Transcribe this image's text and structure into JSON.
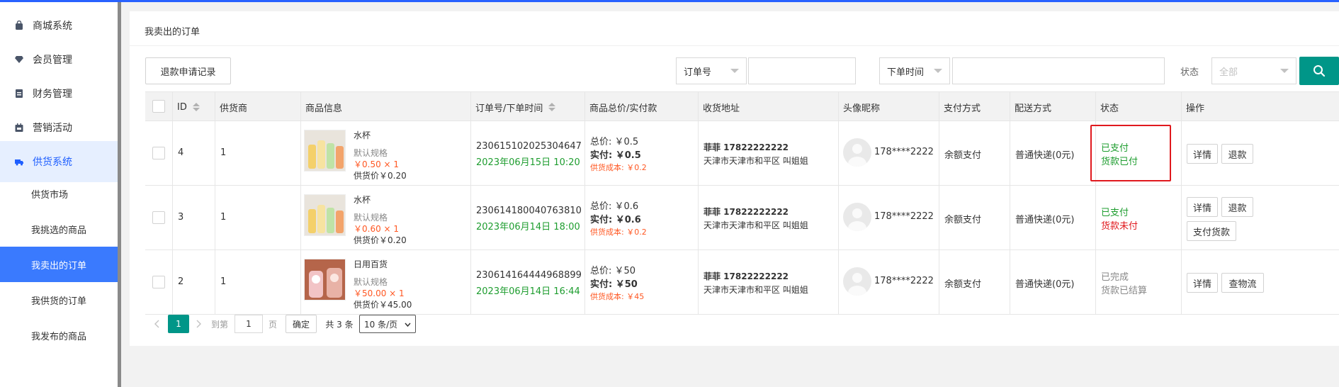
{
  "sidebar": {
    "items": [
      {
        "label": "商城系统",
        "icon": "bag-icon"
      },
      {
        "label": "会员管理",
        "icon": "diamond-icon"
      },
      {
        "label": "财务管理",
        "icon": "finance-icon"
      },
      {
        "label": "营销活动",
        "icon": "calendar-icon"
      },
      {
        "label": "供货系统",
        "icon": "truck-icon"
      }
    ],
    "subitems": [
      {
        "label": "供货市场"
      },
      {
        "label": "我挑选的商品"
      },
      {
        "label": "我卖出的订单"
      },
      {
        "label": "我供货的订单"
      },
      {
        "label": "我发布的商品"
      }
    ]
  },
  "page": {
    "title": "我卖出的订单",
    "refund_button": "退款申请记录",
    "filter1_label": "订单号",
    "filter2_label": "下单时间",
    "status_label": "状态",
    "status_placeholder": "全部"
  },
  "table": {
    "headers": [
      "ID",
      "供货商",
      "商品信息",
      "订单号/下单时间",
      "商品总价/实付款",
      "收货地址",
      "头像昵称",
      "支付方式",
      "配送方式",
      "状态",
      "操作"
    ],
    "rows": [
      {
        "id": "4",
        "supplier": "1",
        "product_name": "水杯",
        "spec": "默认规格",
        "price_qty": "￥0.50 × 1",
        "supply_price": "供货价￥0.20",
        "order_no": "230615102025304647",
        "order_time": "2023年06月15日 10:20",
        "total": "总价: ￥0.5",
        "paid": "实付: ￥0.5",
        "cost": "供货成本: ￥0.2",
        "address_name": "菲菲 17822222222",
        "address": "天津市天津市和平区 叫姐姐",
        "nickname": "178****2222",
        "payment": "余额支付",
        "delivery": "普通快递(0元)",
        "status1": "已支付",
        "status2": "货款已付",
        "actions": [
          "详情",
          "退款"
        ]
      },
      {
        "id": "3",
        "supplier": "1",
        "product_name": "水杯",
        "spec": "默认规格",
        "price_qty": "￥0.60 × 1",
        "supply_price": "供货价￥0.20",
        "order_no": "230614180040763810",
        "order_time": "2023年06月14日 18:00",
        "total": "总价: ￥0.6",
        "paid": "实付: ￥0.6",
        "cost": "供货成本: ￥0.2",
        "address_name": "菲菲 17822222222",
        "address": "天津市天津市和平区 叫姐姐",
        "nickname": "178****2222",
        "payment": "余额支付",
        "delivery": "普通快递(0元)",
        "status1": "已支付",
        "status2": "货款未付",
        "actions": [
          "详情",
          "退款",
          "支付货款"
        ]
      },
      {
        "id": "2",
        "supplier": "1",
        "product_name": "日用百货",
        "spec": "默认规格",
        "price_qty": "￥50.00 × 1",
        "supply_price": "供货价￥45.00",
        "order_no": "230614164444968899",
        "order_time": "2023年06月14日 16:44",
        "total": "总价: ￥50",
        "paid": "实付: ￥50",
        "cost": "供货成本: ￥45",
        "address_name": "菲菲 17822222222",
        "address": "天津市天津市和平区 叫姐姐",
        "nickname": "178****2222",
        "payment": "余额支付",
        "delivery": "普通快递(0元)",
        "status1": "已完成",
        "status2": "货款已结算",
        "actions": [
          "详情",
          "查物流"
        ]
      }
    ]
  },
  "pagination": {
    "current": "1",
    "goto_label": "到第",
    "goto_value": "1",
    "page_unit": "页",
    "confirm": "确定",
    "total": "共 3 条",
    "per_page": "10 条/页"
  },
  "colors": {
    "accent": "#3a7afe",
    "search_button": "#009688",
    "paid_green": "#1e9d2f",
    "price_orange": "#ff5722",
    "unpaid_red": "#e0191e"
  }
}
